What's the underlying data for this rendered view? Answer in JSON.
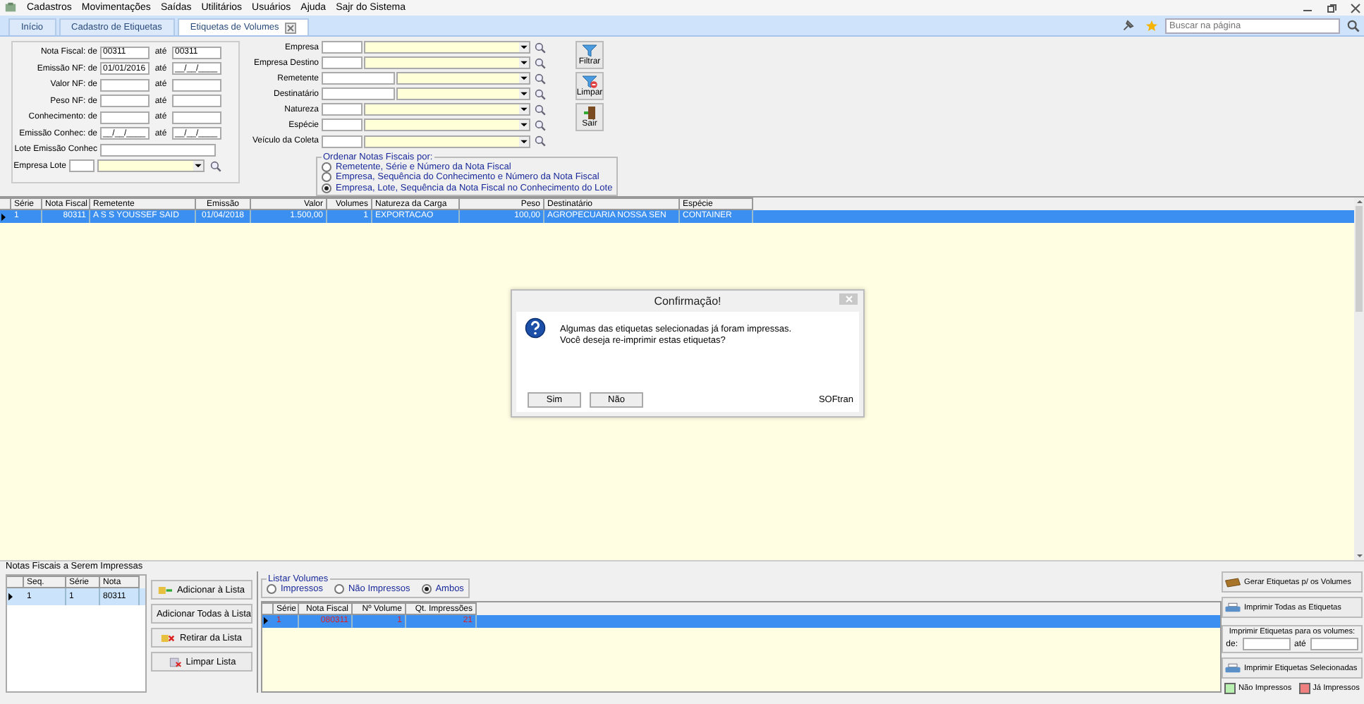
{
  "menu": [
    "Cadastros",
    "Movimentações",
    "Saídas",
    "Utilitários",
    "Usuários",
    "Ajuda",
    "Sajr do Sistema"
  ],
  "tabs": [
    {
      "label": "Início",
      "selected": false,
      "closable": false
    },
    {
      "label": "Cadastro de Etiquetas",
      "selected": false,
      "closable": false
    },
    {
      "label": "Etiquetas de Volumes",
      "selected": true,
      "closable": true
    }
  ],
  "search": {
    "placeholder": "Buscar na página"
  },
  "left_filters": [
    {
      "kind": "range",
      "label": "Nota Fiscal: de",
      "from": "00311",
      "to_label": "até",
      "to": "00311"
    },
    {
      "kind": "range",
      "label": "Emissão NF: de",
      "from": "01/01/2016",
      "to_label": "até",
      "to": "__/__/____"
    },
    {
      "kind": "range",
      "label": "Valor NF: de",
      "to_label": "até"
    },
    {
      "kind": "range",
      "label": "Peso NF: de",
      "to_label": "até"
    },
    {
      "kind": "range",
      "label": "Conhecimento: de",
      "to_label": "até"
    },
    {
      "kind": "range",
      "label": "Emissão Conhec: de",
      "from": "__/__/____",
      "to_label": "até",
      "to": "__/__/____"
    },
    {
      "kind": "single",
      "label": "Lote Emissão Conhec"
    },
    {
      "kind": "lookup",
      "label": "Empresa Lote"
    }
  ],
  "right_filters": [
    {
      "label": "Empresa",
      "kind": "short"
    },
    {
      "label": "Empresa Destino",
      "kind": "short"
    },
    {
      "label": "Remetente",
      "kind": "wide"
    },
    {
      "label": "Destinatário",
      "kind": "wide"
    },
    {
      "label": "Natureza",
      "kind": "short"
    },
    {
      "label": "Espécie",
      "kind": "short"
    },
    {
      "label": "Veículo da Coleta",
      "kind": "short"
    }
  ],
  "action_buttons": [
    {
      "label": "Filtrar",
      "kind": "filter"
    },
    {
      "label": "Limpar",
      "kind": "clear"
    },
    {
      "label": "Sair",
      "kind": "exit"
    }
  ],
  "ordering": {
    "title": "Ordenar Notas Fiscais por:",
    "options": [
      {
        "label": "Remetente, Série e Número da Nota Fiscal",
        "selected": false
      },
      {
        "label": "Empresa, Sequência do Conhecimento e Número da Nota Fiscal",
        "selected": false
      },
      {
        "label": "Empresa, Lote, Sequência da Nota Fiscal no Conhecimento do Lote",
        "selected": true
      }
    ]
  },
  "table": {
    "columns": [
      "Série",
      "Nota Fiscal",
      "Remetente",
      "Emissão",
      "Valor",
      "Volumes",
      "Natureza da Carga",
      "Peso",
      "Destinatário",
      "Espécie"
    ],
    "rows": [
      {
        "selected": true,
        "cells": [
          "1",
          "80311",
          "A S S YOUSSEF SAID",
          "01/04/2018",
          "1.500,00",
          "1",
          "EXPORTACAO",
          "100,00",
          "AGROPECUARIA NOSSA SEN",
          "CONTAINER"
        ]
      }
    ]
  },
  "dialog": {
    "title": "Confirmação!",
    "message": [
      "Algumas das etiquetas selecionadas já foram impressas.",
      "Você deseja re-imprimir estas etiquetas?"
    ],
    "buttons": [
      "Sim",
      "Não"
    ],
    "brand": "SOFtran"
  },
  "notes_list": {
    "title": "Notas Fiscais a Serem Impressas",
    "columns": [
      "Seq.",
      "Série",
      "Nota"
    ],
    "rows": [
      {
        "selected": true,
        "cells": [
          "1",
          "1",
          "80311"
        ]
      }
    ]
  },
  "list_buttons": [
    {
      "label": "Adicionar à Lista",
      "kind": "add"
    },
    {
      "label": "Adicionar Todas à Lista",
      "kind": "add_all"
    },
    {
      "label": "Retirar da Lista",
      "kind": "remove"
    },
    {
      "label": "Limpar Lista",
      "kind": "clear"
    }
  ],
  "volumes": {
    "title": "Listar Volumes",
    "options": [
      {
        "label": "Impressos",
        "selected": false
      },
      {
        "label": "Não Impressos",
        "selected": false
      },
      {
        "label": "Ambos",
        "selected": true
      }
    ],
    "columns": [
      "Série",
      "Nota Fiscal",
      "Nº Volume",
      "Qt. Impressões"
    ],
    "rows": [
      {
        "selected": true,
        "printed": true,
        "cells": [
          "1",
          "080311",
          "1",
          "21"
        ]
      }
    ]
  },
  "generate_button": {
    "label": "Gerar Etiquetas p/ os Volumes"
  },
  "print_all_button": {
    "label": "Imprimir Todas as Etiquetas"
  },
  "print_range": {
    "title": "Imprimir Etiquetas para os volumes:",
    "from_label": "de:",
    "to_label": "até"
  },
  "print_selected_button": {
    "label": "Imprimir Etiquetas Selecionadas"
  },
  "legend": [
    {
      "label": "Não Impressos",
      "color": "#b8f0b0"
    },
    {
      "label": "Já Impressos",
      "color": "#f08080"
    }
  ]
}
